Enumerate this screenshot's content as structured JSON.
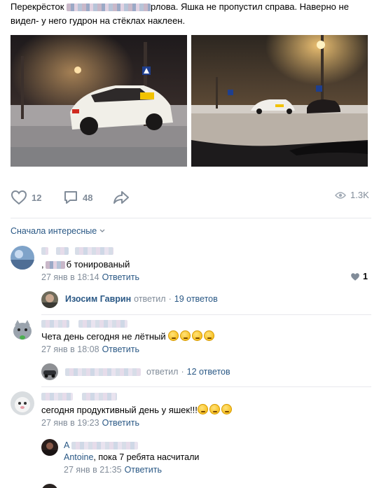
{
  "post": {
    "text_start": "Перекрёсток ",
    "text_mid": "рлова. Яшка не пропустил справа. Наверно не",
    "text_line2": "видел- у него гудрон на стёклах наклеен."
  },
  "actions": {
    "likes": "12",
    "comments": "48",
    "views": "1.3K"
  },
  "sort": {
    "label": "Сначала интересные"
  },
  "comments": [
    {
      "text_prefix": ",",
      "text": "б тонированый",
      "date": "27 янв в 18:14",
      "reply_label": "Ответить",
      "likes": "1",
      "thread": {
        "name": "Изосим Гаврин",
        "action": "ответил",
        "count": "19 ответов"
      }
    },
    {
      "text": "Чета день сегодня не лётный",
      "date": "27 янв в 18:08",
      "reply_label": "Ответить",
      "thread": {
        "action": "ответил",
        "count": "12 ответов"
      }
    },
    {
      "text": "сегодня продуктивный день у яшек!!!",
      "date": "27 янв в 19:23",
      "reply_label": "Ответить"
    }
  ],
  "reply": {
    "name_start": "А",
    "reply_to": "Antoine",
    "text": ", пока 7 ребята насчитали",
    "date": "27 янв в 21:35",
    "reply_label": "Ответить"
  },
  "icons": {
    "like": "heart-icon",
    "comment": "comment-icon",
    "share": "share-icon",
    "views": "eye-icon",
    "sort": "chevron-down-icon"
  },
  "colors": {
    "link": "#2a5885",
    "muted": "#818c99",
    "divider": "#e7e8ec"
  }
}
